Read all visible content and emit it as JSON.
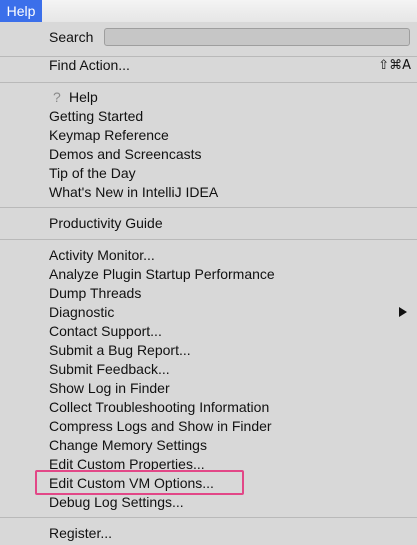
{
  "menubar": {
    "title": "Help"
  },
  "search": {
    "label": "Search",
    "value": "",
    "placeholder": ""
  },
  "find_action": {
    "label": "Find Action...",
    "shortcut": "⇧⌘A"
  },
  "help_group": {
    "help_label": "Help",
    "items": [
      "Getting Started",
      "Keymap Reference",
      "Demos and Screencasts",
      "Tip of the Day",
      "What's New in IntelliJ IDEA"
    ]
  },
  "productivity": {
    "label": "Productivity Guide"
  },
  "tools_group": {
    "items": [
      "Activity Monitor...",
      "Analyze Plugin Startup Performance",
      "Dump Threads",
      "Diagnostic",
      "Contact Support...",
      "Submit a Bug Report...",
      "Submit Feedback...",
      "Show Log in Finder",
      "Collect Troubleshooting Information",
      "Compress Logs and Show in Finder",
      "Change Memory Settings",
      "Edit Custom Properties...",
      "Edit Custom VM Options...",
      "Debug Log Settings..."
    ]
  },
  "register": {
    "label": "Register..."
  },
  "colors": {
    "menubar_highlight": "#3b6fea",
    "annotation_box": "#e24787"
  }
}
